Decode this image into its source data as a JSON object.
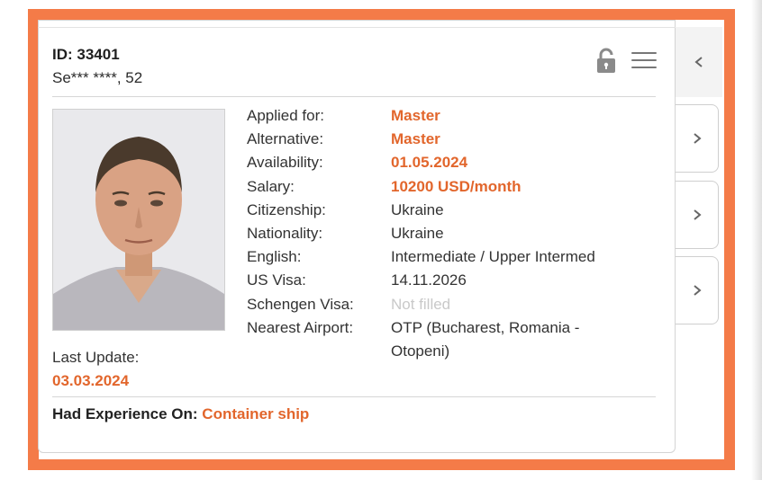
{
  "profile": {
    "id_label": "ID: 33401",
    "name_age": "Se*** ****, 52",
    "photo_icon": "candidate-photo"
  },
  "details": [
    {
      "label": "Applied for:",
      "value": "Master",
      "style": "accent"
    },
    {
      "label": "Alternative:",
      "value": "Master",
      "style": "accent"
    },
    {
      "label": "Availability:",
      "value": "01.05.2024",
      "style": "accent"
    },
    {
      "label": "Salary:",
      "value": "10200 USD/month",
      "style": "accent"
    },
    {
      "label": "Citizenship:",
      "value": "Ukraine",
      "style": "normal"
    },
    {
      "label": "Nationality:",
      "value": "Ukraine",
      "style": "normal"
    },
    {
      "label": "English:",
      "value": "Intermediate / Upper Intermed",
      "style": "normal"
    },
    {
      "label": "US Visa:",
      "value": "14.11.2026",
      "style": "normal"
    },
    {
      "label": "Schengen Visa:",
      "value": "Not filled",
      "style": "muted"
    },
    {
      "label": "Nearest Airport:",
      "value": "OTP (Bucharest, Romania -",
      "value_line2": "Otopeni)",
      "style": "normal"
    }
  ],
  "last_update": {
    "label": "Last Update:",
    "value": "03.03.2024"
  },
  "experience": {
    "label": "Had Experience On:",
    "value": "Container ship"
  },
  "icons": {
    "lock": "lock-icon",
    "menu": "hamburger-menu-icon",
    "back": "chevron-left-icon",
    "next": "chevron-right-icon"
  },
  "colors": {
    "accent": "#e2662c",
    "frame": "#f47b48",
    "muted": "#c9c9c9"
  }
}
